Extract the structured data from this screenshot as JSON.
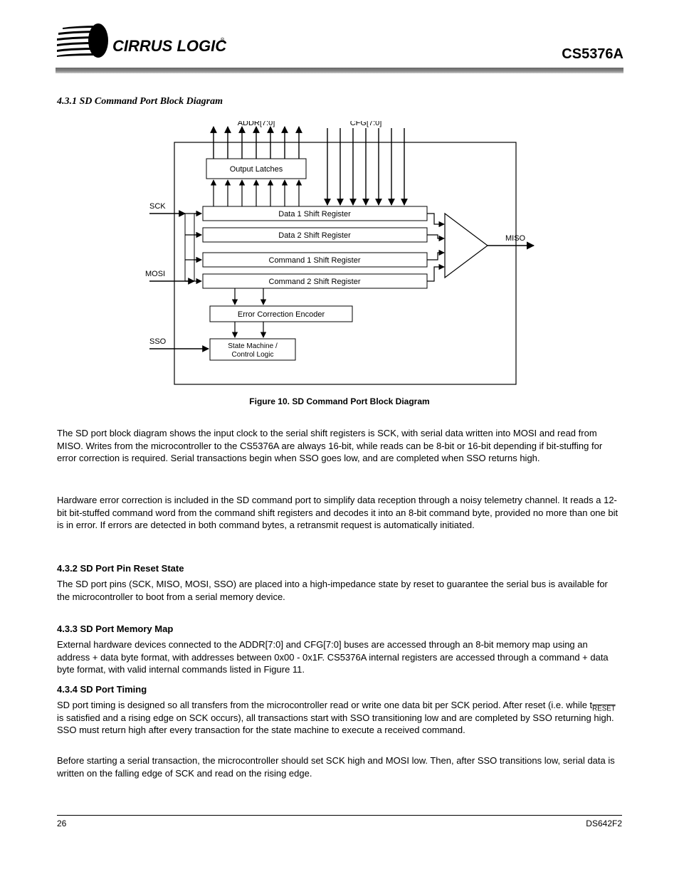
{
  "header": {
    "logo_text": "CIRRUS LOGIC",
    "doc_id": "CS5376A"
  },
  "section": {
    "title": "4.3.1 SD Command Port Block Diagram"
  },
  "figure": {
    "caption": "Figure 10.  SD Command Port Block Diagram",
    "labels": {
      "sck": "SCK",
      "mosi": "MOSI",
      "miso": "MISO",
      "sso": "SSO",
      "addr": "ADDR[7:0]",
      "cfg": "CFG[7:0]",
      "output_latches": "Output Latches",
      "data1": "Data 1 Shift Register",
      "data2": "Data 2 Shift Register",
      "cmd1": "Command 1 Shift Register",
      "cmd2": "Command 2 Shift Register",
      "ecode": "Error Correction Encoder",
      "state": "State Machine / Control Logic"
    }
  },
  "chart_data": {
    "type": "block-diagram",
    "inputs_left": [
      "SCK",
      "MOSI",
      "SSO"
    ],
    "outputs_right": [
      "MISO"
    ],
    "top_outputs": "ADDR[7:0]",
    "top_inputs": "CFG[7:0]",
    "blocks": [
      "Output Latches",
      "Data 1 Shift Register",
      "Data 2 Shift Register",
      "Command 1 Shift Register",
      "Command 2 Shift Register",
      "Error Correction Encoder",
      "State Machine / Control Logic"
    ],
    "flow_note": "SCK/MOSI feed shift registers; shift registers feed mux then MISO; Output Latches feed ADDR outputs and are fed from Data registers; CFG inputs feed Data 1 register; Command registers feed Error Correction Encoder which feeds State Machine; SSO feeds State Machine."
  },
  "paragraphs": {
    "p1": "The SD port block diagram shows the input clock to the serial shift registers is SCK, with serial data written into MOSI and read from MISO. Writes from the microcontroller to the CS5376A are always 16-bit, while reads can be 8-bit or 16-bit depending if bit-stuffing for error correction is required. Serial transactions begin when SSO goes low, and are completed when SSO returns high.",
    "p2": "Hardware error correction is included in the SD command port to simplify data reception through a noisy telemetry channel. It reads a 12-bit bit-stuffed command word from the command shift registers and decodes it into an 8-bit command byte, provided no more than one bit is in error. If errors are detected in both command bytes, a retransmit request is automatically initiated.",
    "head1": "4.3.2 SD Port Pin Reset State",
    "p3": "The SD port pins (SCK, MISO, MOSI, SSO) are placed into a high-impedance state by reset to guarantee the serial bus is available for the microcontroller to boot from a serial memory device.",
    "head2": "4.3.3 SD Port Memory Map",
    "p4": "External hardware devices connected to the ADDR[7:0] and CFG[7:0] buses are accessed through an 8-bit memory map using an address + data byte format, with addresses between 0x00 - 0x1F. CS5376A internal registers are accessed through a command + data byte format, with valid internal commands listed in Figure 11.",
    "head3": "4.3.4 SD Port Timing",
    "p5": "SD port timing is designed so all transfers from the microcontroller read or write one data bit per SCK period. All transactions start with SSO transitioning low and are completed by SSO returning high. SSO must return high after every transaction for the state machine to execute a received command.",
    "p6": "Before starting a serial transaction, the microcontroller should set SCK high and MOSI low. Then, after SSO transitions low, serial data is written on the falling edge of SCK and read on the rising edge."
  },
  "footer": {
    "page": "26",
    "ds": "DS642F2"
  },
  "sub": {
    "reset": "RESET"
  }
}
